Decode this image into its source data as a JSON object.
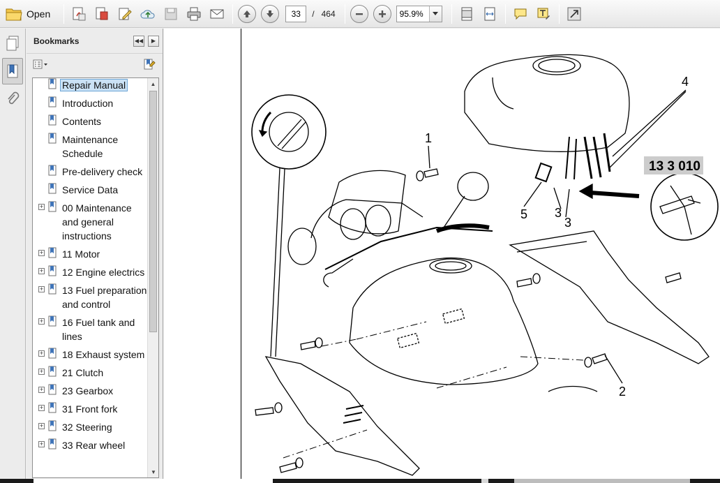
{
  "toolbar": {
    "open_label": "Open",
    "current_page": "33",
    "page_separator": "/",
    "total_pages": "464",
    "zoom": "95.9%"
  },
  "bookmarks": {
    "title": "Bookmarks",
    "items": [
      {
        "label": "Repair Manual",
        "expandable": false,
        "selected": true
      },
      {
        "label": "Introduction",
        "expandable": false
      },
      {
        "label": "Contents",
        "expandable": false
      },
      {
        "label": "Maintenance Schedule",
        "expandable": false
      },
      {
        "label": "Pre-delivery check",
        "expandable": false
      },
      {
        "label": "Service Data",
        "expandable": false
      },
      {
        "label": "00 Maintenance and general instructions",
        "expandable": true
      },
      {
        "label": "11 Motor",
        "expandable": true
      },
      {
        "label": "12 Engine electrics",
        "expandable": true
      },
      {
        "label": "13 Fuel preparation and control",
        "expandable": true
      },
      {
        "label": "16 Fuel tank and lines",
        "expandable": true
      },
      {
        "label": "18 Exhaust system",
        "expandable": true
      },
      {
        "label": "21 Clutch",
        "expandable": true
      },
      {
        "label": "23 Gearbox",
        "expandable": true
      },
      {
        "label": "31 Front fork",
        "expandable": true
      },
      {
        "label": "32 Steering",
        "expandable": true
      },
      {
        "label": "33 Rear wheel",
        "expandable": true
      }
    ]
  },
  "diagram": {
    "callouts": [
      "1",
      "2",
      "3",
      "3",
      "4",
      "5"
    ],
    "tool_label": "13 3 010"
  }
}
